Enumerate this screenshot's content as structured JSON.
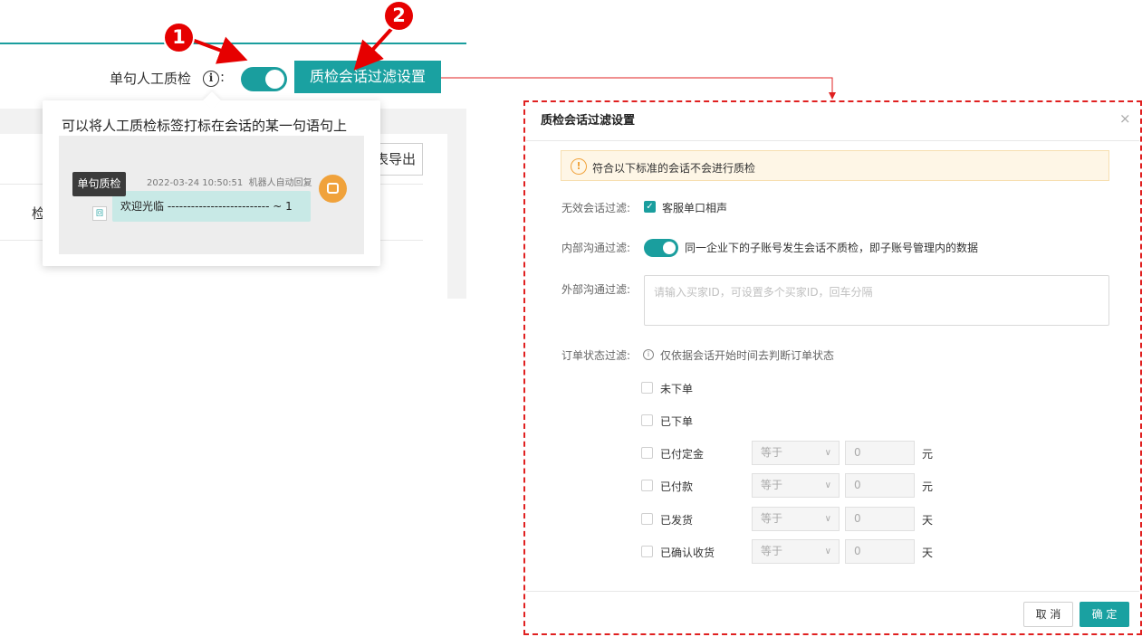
{
  "colors": {
    "accent": "#1aa1a1",
    "marker": "#e60000",
    "frame": "#e02020"
  },
  "left": {
    "single_label": "单句人工质检",
    "info_glyph": "i",
    "colon": ":",
    "toggle_on": true,
    "filter_button": "质检会话过滤设置",
    "export_text": "表导出",
    "column_text": "检"
  },
  "tooltip": {
    "title": "可以将人工质检标签打标在会话的某一句语句上",
    "badge": "单句质检",
    "time": "2022-03-24 10:50:51",
    "sender": "机器人自动回复",
    "message": "欢迎光临 -------------------------- ~ 1",
    "chat_icon": "回"
  },
  "markers": {
    "one": "1",
    "two": "2"
  },
  "dialog": {
    "title": "质检会话过滤设置",
    "close": "×",
    "notice_icon": "!",
    "notice": "符合以下标准的会话不会进行质检",
    "invalid_label": "无效会话过滤:",
    "invalid_check": "✓",
    "invalid_text": "客服单口相声",
    "internal_label": "内部沟通过滤:",
    "internal_on": true,
    "internal_text": "同一企业下的子账号发生会话不质检，即子账号管理内的数据",
    "external_label": "外部沟通过滤:",
    "external_placeholder": "请输入买家ID，可设置多个买家ID，回车分隔",
    "order_label": "订单状态过滤:",
    "order_hint_icon": "i",
    "order_hint": "仅依据会话开始时间去判断订单状态",
    "orders": [
      {
        "label": "未下单"
      },
      {
        "label": "已下单"
      },
      {
        "label": "已付定金",
        "select": "等于",
        "value": "0",
        "unit": "元"
      },
      {
        "label": "已付款",
        "select": "等于",
        "value": "0",
        "unit": "元"
      },
      {
        "label": "已发货",
        "select": "等于",
        "value": "0",
        "unit": "天"
      },
      {
        "label": "已确认收货",
        "select": "等于",
        "value": "0",
        "unit": "天"
      }
    ],
    "chevron": "∨",
    "cancel": "取 消",
    "ok": "确 定"
  }
}
